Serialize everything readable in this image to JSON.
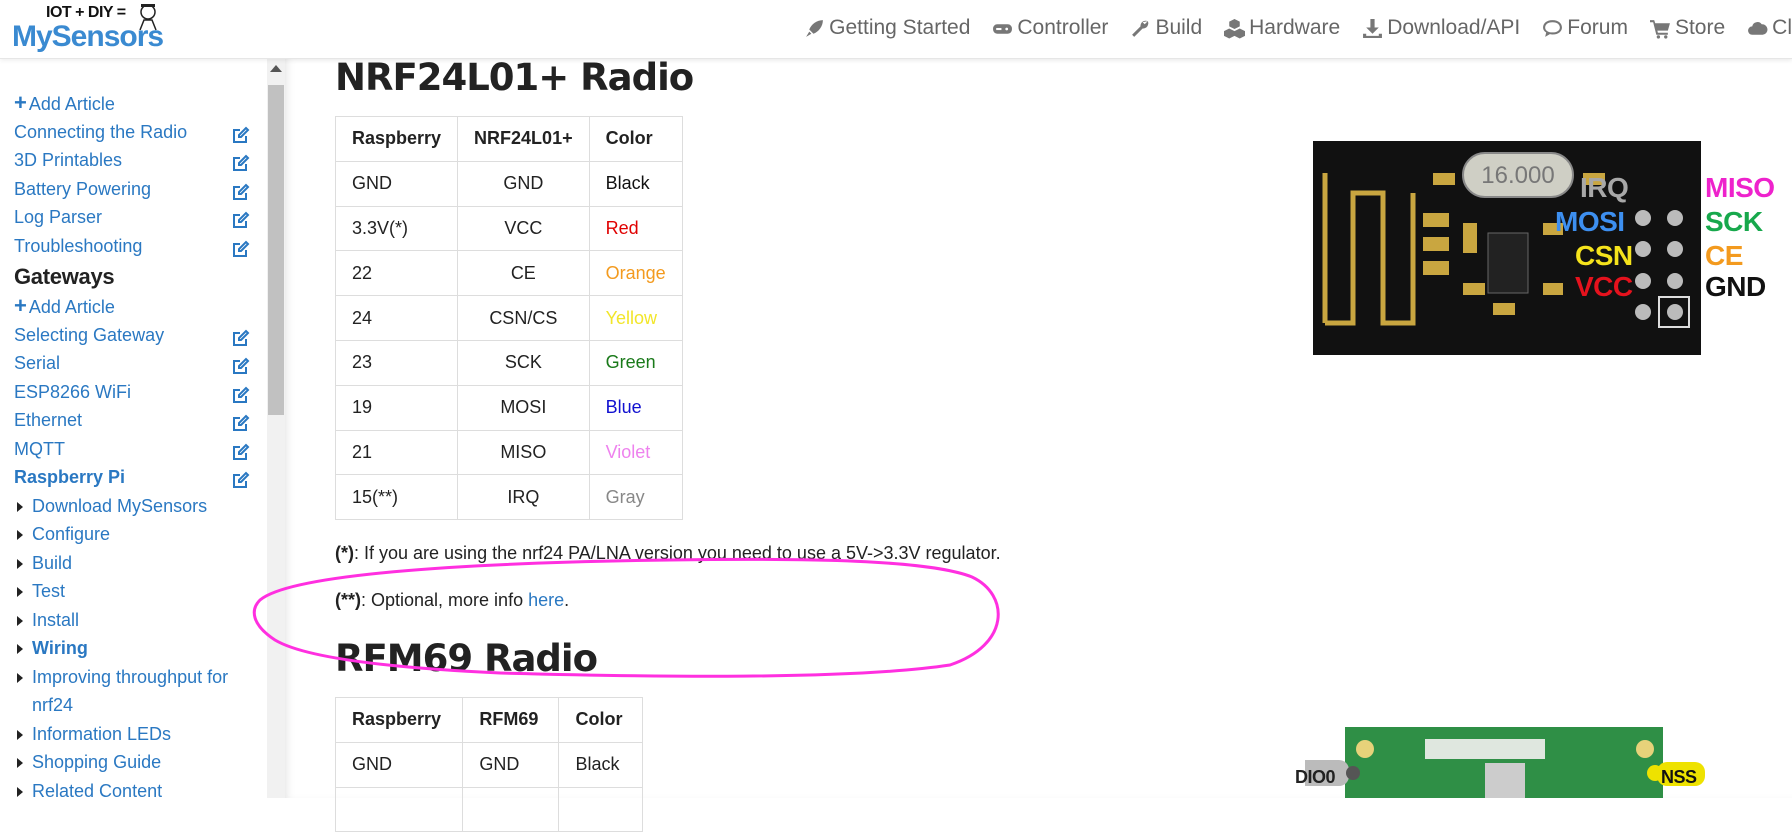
{
  "logo": {
    "tagline": "IOT + DIY =",
    "brand": "MySensors"
  },
  "nav": [
    {
      "label": "Getting Started",
      "icon": "rocket-icon"
    },
    {
      "label": "Controller",
      "icon": "gamepad-icon"
    },
    {
      "label": "Build",
      "icon": "wrench-icon"
    },
    {
      "label": "Hardware",
      "icon": "cubes-icon"
    },
    {
      "label": "Download/API",
      "icon": "download-icon"
    },
    {
      "label": "Forum",
      "icon": "comment-icon"
    },
    {
      "label": "Store",
      "icon": "cart-icon"
    },
    {
      "label": "Cl",
      "icon": "cloud-icon"
    }
  ],
  "sidebar": {
    "add_article_1": "Add Article",
    "items_top": [
      "Connecting the Radio",
      "3D Printables",
      "Battery Powering",
      "Log Parser",
      "Troubleshooting"
    ],
    "gateways_heading": "Gateways",
    "add_article_2": "Add Article",
    "items_gateways": [
      "Selecting Gateway",
      "Serial",
      "ESP8266 WiFi",
      "Ethernet",
      "MQTT"
    ],
    "active_item": "Raspberry Pi",
    "sub_items": [
      "Download MySensors",
      "Configure",
      "Build",
      "Test",
      "Install",
      "Wiring",
      "Improving throughput for nrf24",
      "Information LEDs",
      "Shopping Guide",
      "Related Content"
    ]
  },
  "section1": {
    "title": "NRF24L01+ Radio",
    "headers": [
      "Raspberry",
      "NRF24L01+",
      "Color"
    ],
    "rows": [
      [
        "GND",
        "GND",
        "Black"
      ],
      [
        "3.3V(*)",
        "VCC",
        "Red"
      ],
      [
        "22",
        "CE",
        "Orange"
      ],
      [
        "24",
        "CSN/CS",
        "Yellow"
      ],
      [
        "23",
        "SCK",
        "Green"
      ],
      [
        "19",
        "MOSI",
        "Blue"
      ],
      [
        "21",
        "MISO",
        "Violet"
      ],
      [
        "15(**)",
        "IRQ",
        "Gray"
      ]
    ],
    "row_colors": [
      "#111111",
      "#e00000",
      "#f39a1e",
      "#f2e62a",
      "#1a7a1a",
      "#1010d0",
      "#ee82ee",
      "#888888"
    ],
    "note1_mark": "(*)",
    "note1_text": ": If you are using the nrf24 PA/LNA version you need to use a 5V->3.3V regulator.",
    "note2_mark": "(**)",
    "note2_text": ": Optional, more info ",
    "note2_link": "here",
    "note2_end": "."
  },
  "module1": {
    "crystal_text": "16.000",
    "pins_left": [
      "IRQ",
      "MOSI",
      "CSN",
      "VCC"
    ],
    "pins_right": [
      "MISO",
      "SCK",
      "CE",
      "GND"
    ],
    "pins_left_colors": [
      "#a8a8a8",
      "#3d8ff0",
      "#f5e31c",
      "#e5121d"
    ],
    "pins_right_colors": [
      "#ee22cc",
      "#17a84c",
      "#f39a1e",
      "#111111"
    ]
  },
  "section2": {
    "title": "RFM69 Radio",
    "headers": [
      "Raspberry",
      "RFM69",
      "Color"
    ],
    "rows": [
      [
        "GND",
        "GND",
        "Black"
      ]
    ]
  },
  "module2": {
    "pin_left": "DIO0",
    "pin_right": "NSS"
  },
  "annotation_color": "#ff2fe0",
  "link_color": "#2a78c2"
}
